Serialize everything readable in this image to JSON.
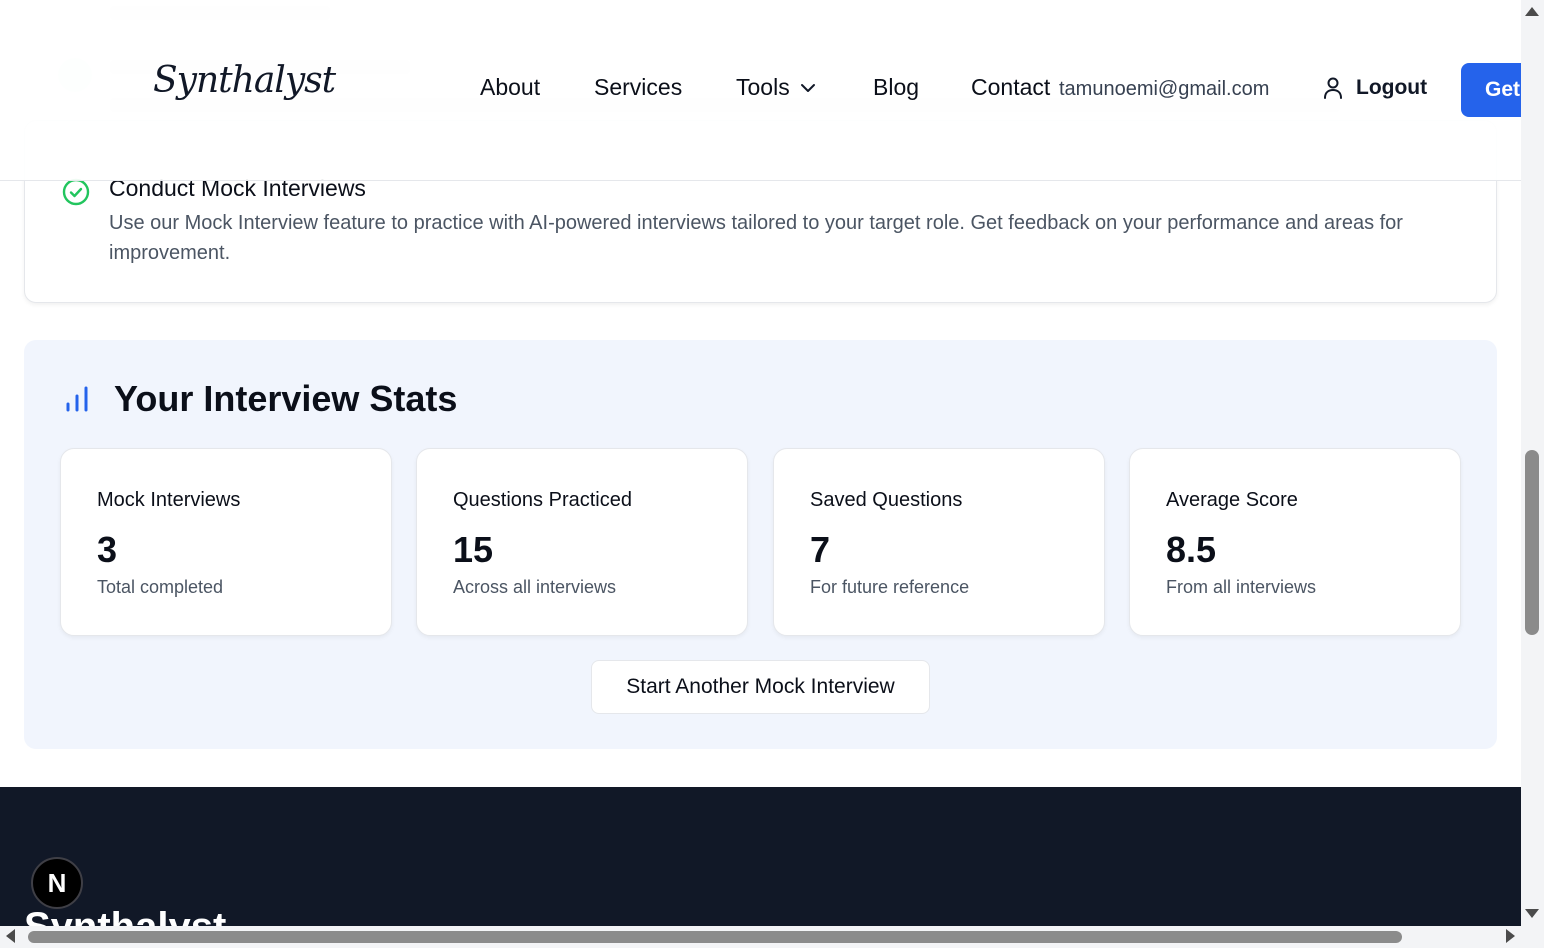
{
  "header": {
    "logo_text": "Synthalyst",
    "nav": {
      "about": "About",
      "services": "Services",
      "tools": "Tools",
      "blog": "Blog",
      "contact": "Contact"
    },
    "user_email": "tamunoemi@gmail.com",
    "logout_label": "Logout",
    "cta_label": "Get"
  },
  "steps": {
    "item_title": "Conduct Mock Interviews",
    "item_description": "Use our Mock Interview feature to practice with AI-powered interviews tailored to your target role. Get feedback on your performance and areas for improvement."
  },
  "stats": {
    "title": "Your Interview Stats",
    "cards": [
      {
        "label": "Mock Interviews",
        "value": "3",
        "sub": "Total completed"
      },
      {
        "label": "Questions Practiced",
        "value": "15",
        "sub": "Across all interviews"
      },
      {
        "label": "Saved Questions",
        "value": "7",
        "sub": "For future reference"
      },
      {
        "label": "Average Score",
        "value": "8.5",
        "sub": "From all interviews"
      }
    ],
    "cta_label": "Start Another Mock Interview"
  },
  "footer": {
    "brand": "Synthalyst"
  },
  "dev_badge": "N",
  "colors": {
    "primary": "#2563eb",
    "check_green": "#22c55e",
    "stats_bg": "#f1f5fd",
    "footer_bg": "#111827"
  },
  "icons": {
    "check": "circle-check-icon",
    "stats": "bar-chart-icon",
    "user": "user-icon",
    "chevron": "chevron-down-icon"
  }
}
